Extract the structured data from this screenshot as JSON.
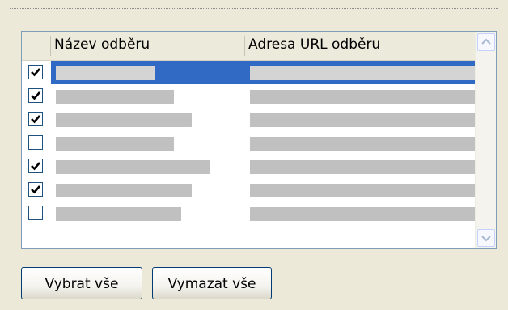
{
  "feed_list": {
    "columns": [
      "",
      "Název odběru",
      "Adresa URL odběru"
    ],
    "rows": [
      {
        "checked": true,
        "selected": true,
        "name_redacted": true,
        "url_redacted": true
      },
      {
        "checked": true,
        "selected": false,
        "name_redacted": true,
        "url_redacted": true
      },
      {
        "checked": true,
        "selected": false,
        "name_redacted": true,
        "url_redacted": true
      },
      {
        "checked": false,
        "selected": false,
        "name_redacted": true,
        "url_redacted": true
      },
      {
        "checked": true,
        "selected": false,
        "name_redacted": true,
        "url_redacted": true
      },
      {
        "checked": true,
        "selected": false,
        "name_redacted": true,
        "url_redacted": true
      },
      {
        "checked": false,
        "selected": false,
        "name_redacted": true,
        "url_redacted": true
      }
    ]
  },
  "buttons": {
    "select_all_label": "Vybrat vše",
    "clear_all_label": "Vymazat vše"
  },
  "icons": {
    "checkbox_mark": "checkmark-icon",
    "scroll_up": "chevron-up-icon",
    "scroll_down": "chevron-down-icon"
  },
  "colors": {
    "selection": "#316ac5",
    "redaction": "#c0c0c0",
    "dialog_bg": "#ece9d8",
    "button_border": "#003c74"
  }
}
